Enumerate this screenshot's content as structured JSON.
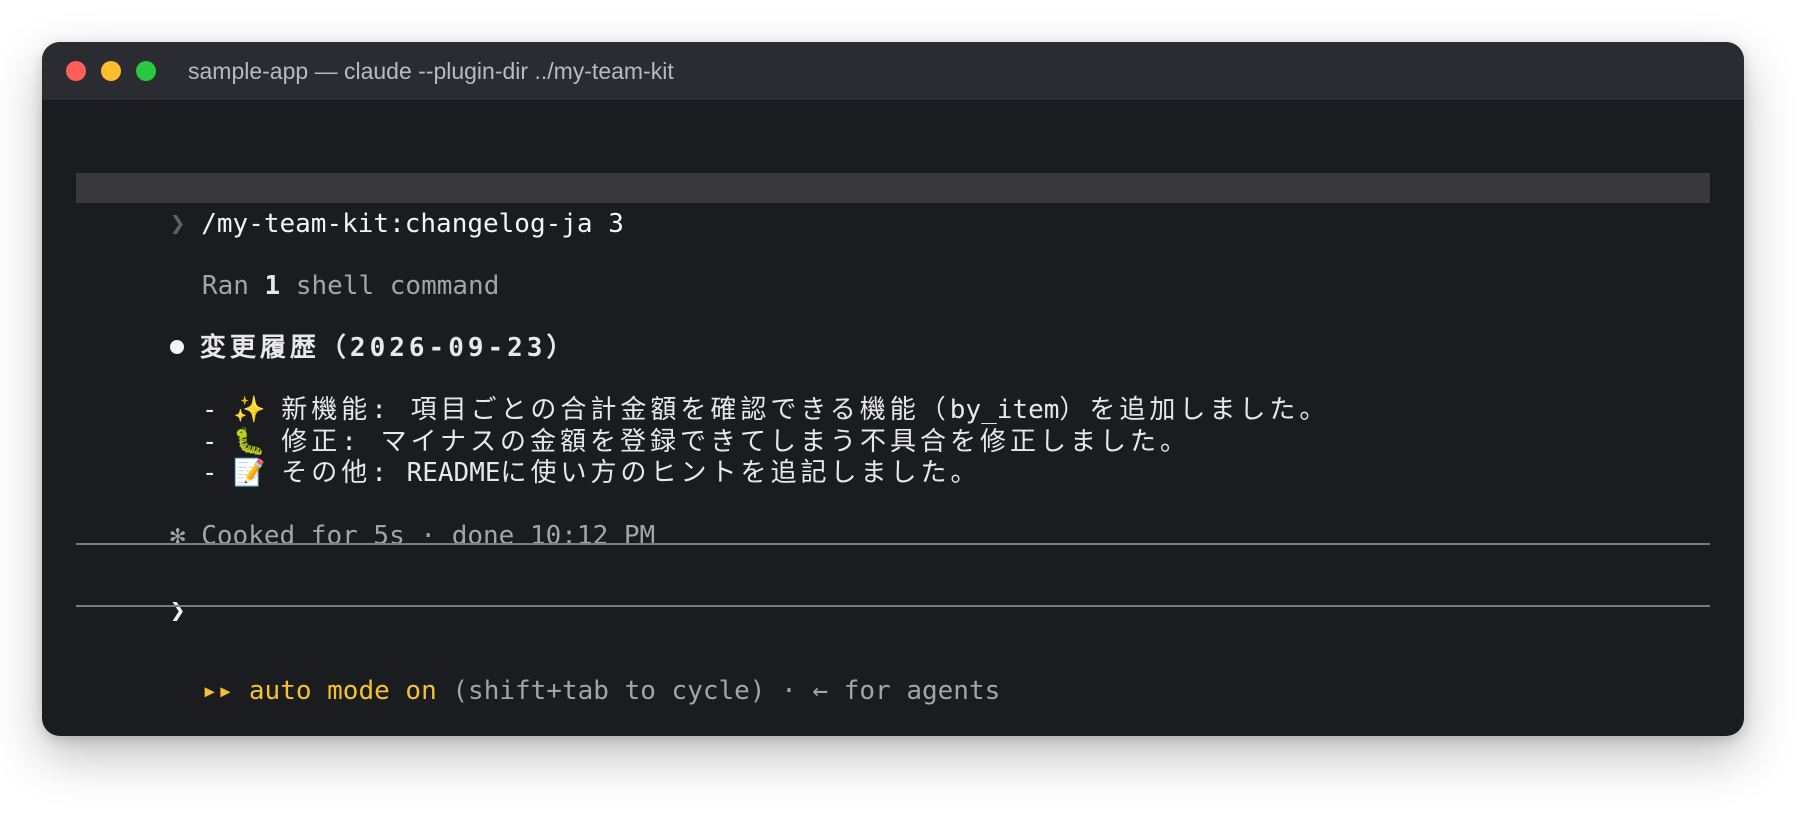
{
  "window": {
    "title": "sample-app — claude --plugin-dir ../my-team-kit"
  },
  "terminal": {
    "prompt_glyph": "❯",
    "command": "/my-team-kit:changelog-ja 3",
    "ran_prefix": "Ran ",
    "ran_count": "1",
    "ran_suffix": " shell command",
    "heading": "変更履歴（2026-09-23）",
    "items": [
      {
        "dash": "-",
        "emoji": "✨",
        "label": "新機能:",
        "text_before": " 項目ごとの合計金額を確認できる機能（",
        "code": "by_item",
        "text_after": "）を追加しました。"
      },
      {
        "dash": "-",
        "emoji": "🐛",
        "label": "修正:",
        "text": " マイナスの金額を登録できてしまう不具合を修正しました。"
      },
      {
        "dash": "-",
        "emoji": "📝",
        "label": "その他:",
        "code": " README",
        "text": "に使い方のヒントを追記しました。"
      }
    ],
    "status_glyph": "✻",
    "status": "Cooked for 5s · done 10:12 PM",
    "input_prompt": "❯",
    "footer": {
      "arrows": "▸▸",
      "mode": "auto mode on",
      "hint": " (shift+tab to cycle) · ← for agents"
    }
  },
  "colors": {
    "background": "#1b1c20",
    "titlebar": "#2b2c31",
    "accent_yellow": "#f5c12e",
    "muted": "#a3a3a8"
  }
}
